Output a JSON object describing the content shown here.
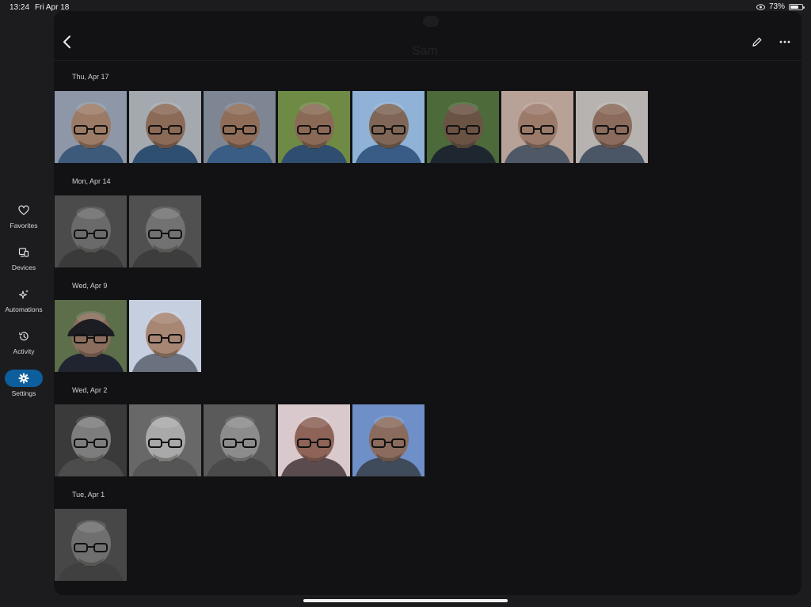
{
  "status": {
    "time": "13:24",
    "date": "Fri Apr 18",
    "battery": "73%",
    "battery_level": 0.73
  },
  "header": {
    "title": "Sam"
  },
  "sidebar": {
    "items": [
      {
        "label": "Favorites",
        "icon": "heart-icon",
        "active": false
      },
      {
        "label": "Devices",
        "icon": "devices-icon",
        "active": false
      },
      {
        "label": "Automations",
        "icon": "sparkle-icon",
        "active": false
      },
      {
        "label": "Activity",
        "icon": "history-icon",
        "active": false
      },
      {
        "label": "Settings",
        "icon": "gear-icon",
        "active": true
      }
    ]
  },
  "groups": [
    {
      "date": "Thu, Apr 17",
      "photos": [
        {
          "bg": "#8d97a8",
          "skin": "#9c7b66",
          "shirt": "#3d5a7a",
          "hat": false
        },
        {
          "bg": "#a4a9b0",
          "skin": "#8b6a57",
          "shirt": "#2f4f70",
          "hat": false
        },
        {
          "bg": "#7d8692",
          "skin": "#8f6d59",
          "shirt": "#3a5d86",
          "hat": false
        },
        {
          "bg": "#6f8a45",
          "skin": "#8a6a56",
          "shirt": "#2f4d6e",
          "hat": false
        },
        {
          "bg": "#8fb2d6",
          "skin": "#7f6656",
          "shirt": "#385c86",
          "hat": false
        },
        {
          "bg": "#4d6a3b",
          "skin": "#6b5344",
          "shirt": "#1e2730",
          "hat": false
        },
        {
          "bg": "#b8a197",
          "skin": "#9c7a6a",
          "shirt": "#4f5866",
          "hat": false
        },
        {
          "bg": "#b7b3b0",
          "skin": "#8a6b5c",
          "shirt": "#4a5566",
          "hat": false
        }
      ]
    },
    {
      "date": "Mon, Apr 14",
      "photos": [
        {
          "bg": "#4b4b4b",
          "skin": "#6a6a6a",
          "shirt": "#3a3a3a",
          "hat": false
        },
        {
          "bg": "#505050",
          "skin": "#727272",
          "shirt": "#3d3d3d",
          "hat": false
        }
      ]
    },
    {
      "date": "Wed, Apr 9",
      "photos": [
        {
          "bg": "#5d6e4a",
          "skin": "#8a6d5c",
          "shirt": "#1f2430",
          "hat": true
        },
        {
          "bg": "#c6cfe0",
          "skin": "#a88674",
          "shirt": "#6a7280",
          "hat": false
        }
      ]
    },
    {
      "date": "Wed, Apr 2",
      "photos": [
        {
          "bg": "#3a3a3a",
          "skin": "#7d7d7d",
          "shirt": "#4c4c4c",
          "hat": false
        },
        {
          "bg": "#686868",
          "skin": "#a9a9a9",
          "shirt": "#555555",
          "hat": false
        },
        {
          "bg": "#5a5a5a",
          "skin": "#8c8c8c",
          "shirt": "#4a4a4a",
          "hat": false
        },
        {
          "bg": "#d9c9cc",
          "skin": "#8e6458",
          "shirt": "#5a4b4e",
          "hat": false
        },
        {
          "bg": "#6f8fc8",
          "skin": "#8a6b5d",
          "shirt": "#3f4a5a",
          "hat": false
        }
      ]
    },
    {
      "date": "Tue, Apr 1",
      "photos": [
        {
          "bg": "#474747",
          "skin": "#6f6f6f",
          "shirt": "#404040",
          "hat": false
        }
      ]
    }
  ]
}
